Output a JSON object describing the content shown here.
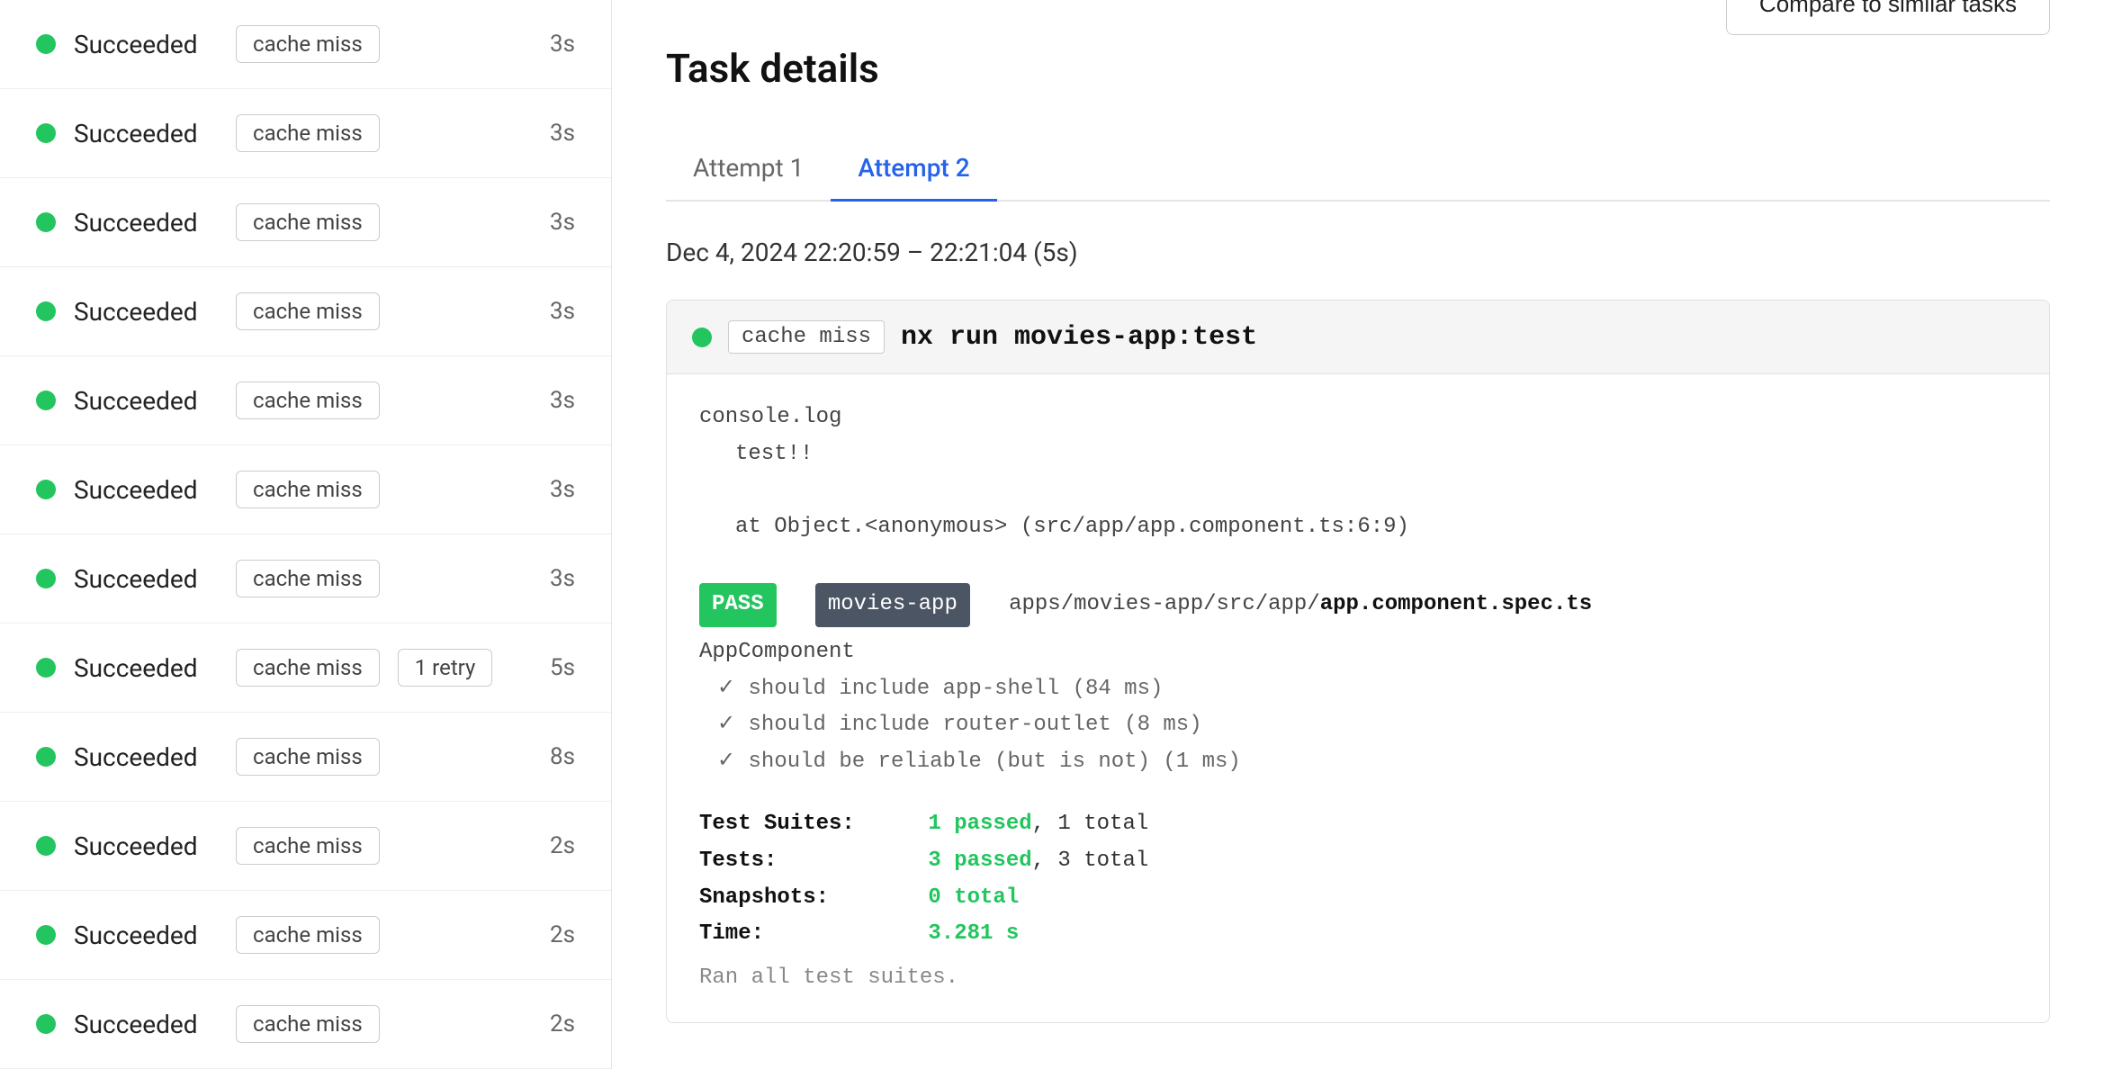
{
  "left_panel": {
    "rows": [
      {
        "status": "Succeeded",
        "badge": "cache miss",
        "duration": "3s",
        "retry": null
      },
      {
        "status": "Succeeded",
        "badge": "cache miss",
        "duration": "3s",
        "retry": null
      },
      {
        "status": "Succeeded",
        "badge": "cache miss",
        "duration": "3s",
        "retry": null
      },
      {
        "status": "Succeeded",
        "badge": "cache miss",
        "duration": "3s",
        "retry": null
      },
      {
        "status": "Succeeded",
        "badge": "cache miss",
        "duration": "3s",
        "retry": null
      },
      {
        "status": "Succeeded",
        "badge": "cache miss",
        "duration": "3s",
        "retry": null
      },
      {
        "status": "Succeeded",
        "badge": "cache miss",
        "duration": "3s",
        "retry": null
      },
      {
        "status": "Succeeded",
        "badge": "cache miss",
        "duration": "5s",
        "retry": "1 retry"
      },
      {
        "status": "Succeeded",
        "badge": "cache miss",
        "duration": "8s",
        "retry": null
      },
      {
        "status": "Succeeded",
        "badge": "cache miss",
        "duration": "2s",
        "retry": null
      },
      {
        "status": "Succeeded",
        "badge": "cache miss",
        "duration": "2s",
        "retry": null
      },
      {
        "status": "Succeeded",
        "badge": "cache miss",
        "duration": "2s",
        "retry": null
      }
    ]
  },
  "right_panel": {
    "title": "Task details",
    "compare_button": "Compare to similar tasks",
    "tabs": [
      {
        "label": "Attempt 1",
        "active": false
      },
      {
        "label": "Attempt 2",
        "active": true
      }
    ],
    "datetime_range": "Dec 4, 2024 22:20:59 – 22:21:04 (5s)",
    "terminal": {
      "cache_miss": "cache miss",
      "command": "nx run movies-app:test",
      "lines": [
        "console.log",
        "    test!!",
        "",
        "    at Object.<anonymous> (src/app/app.component.ts:6:9)",
        ""
      ],
      "pass_badge": "PASS",
      "movies_app_badge": "movies-app",
      "file_path_prefix": "apps/movies-app/src/app/",
      "file_path_bold": "app.component.spec.ts",
      "app_component": "AppComponent",
      "checks": [
        "✓ should include app-shell (84 ms)",
        "✓ should include router-outlet (8 ms)",
        "✓ should be reliable (but is not) (1 ms)"
      ],
      "suites": [
        {
          "label": "Test Suites:",
          "value": "1 passed",
          "suffix": ", 1 total"
        },
        {
          "label": "Tests:",
          "value": "3 passed",
          "suffix": ", 3 total"
        },
        {
          "label": "Snapshots:",
          "value": "0 total",
          "suffix": ""
        },
        {
          "label": "Time:",
          "value": "3.281 s",
          "suffix": ""
        }
      ],
      "ran_all": "Ran all test suites."
    }
  }
}
